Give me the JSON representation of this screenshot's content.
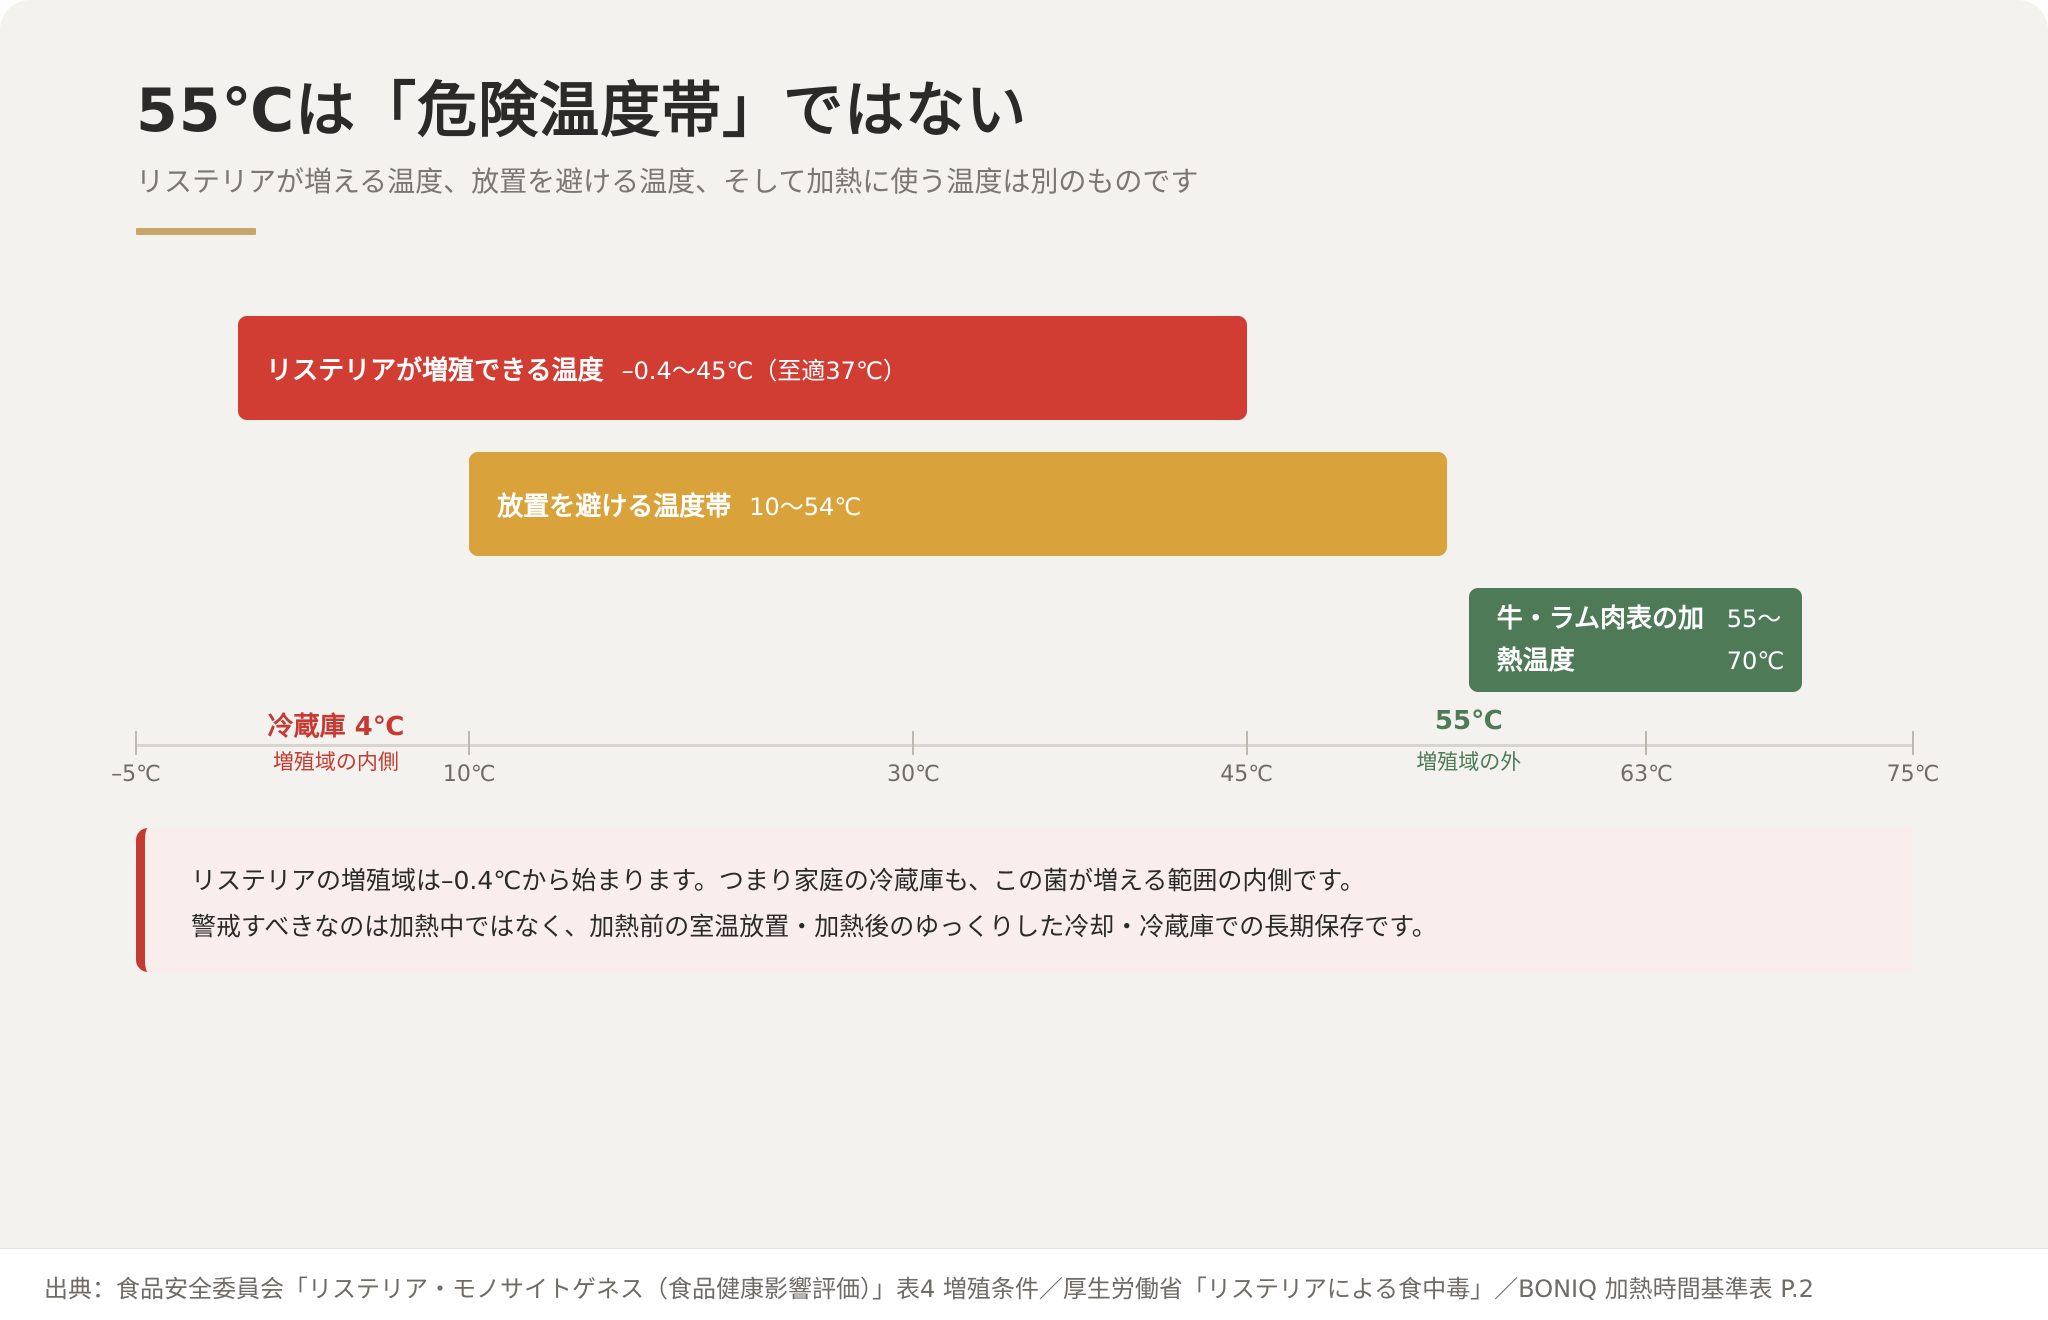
{
  "header": {
    "title": "55℃は「危険温度帯」ではない",
    "subtitle": "リステリアが増える温度、放置を避ける温度、そして加熱に使う温度は別のものです"
  },
  "colors": {
    "red": "#d13c33",
    "amber": "#d9a23b",
    "green": "#4e7a58",
    "accent": "#c9a56a",
    "background": "#f4f2ee"
  },
  "chart_data": {
    "type": "bar",
    "orientation": "horizontal-range",
    "x_unit": "℃",
    "xlim": [
      -5,
      75
    ],
    "ticks": [
      {
        "value": -5,
        "label": "–5℃"
      },
      {
        "value": 10,
        "label": "10℃"
      },
      {
        "value": 30,
        "label": "30℃"
      },
      {
        "value": 45,
        "label": "45℃"
      },
      {
        "value": 63,
        "label": "63℃"
      },
      {
        "value": 75,
        "label": "75℃"
      }
    ],
    "ranges": [
      {
        "name": "リステリアが増殖できる温度",
        "range_label": "–0.4〜45℃（至適37℃）",
        "start": -0.4,
        "end": 45,
        "color": "#d13c33"
      },
      {
        "name": "放置を避ける温度帯",
        "range_label": "10〜54℃",
        "start": 10,
        "end": 54,
        "color": "#d9a23b"
      },
      {
        "name": "牛・ラム肉表の加熱温度",
        "range_label": "55〜70℃",
        "start": 55,
        "end": 70,
        "color": "#4e7a58"
      }
    ],
    "markers": [
      {
        "value": 4,
        "label": "冷蔵庫 4℃",
        "note": "増殖域の内側",
        "color": "#c53a33"
      },
      {
        "value": 55,
        "label": "55℃",
        "note": "増殖域の外",
        "color": "#4e7a58"
      }
    ]
  },
  "note": {
    "line1": "リステリアの増殖域は–0.4℃から始まります。つまり家庭の冷蔵庫も、この菌が増える範囲の内側です。",
    "line2": "警戒すべきなのは加熱中ではなく、加熱前の室温放置・加熱後のゆっくりした冷却・冷蔵庫での長期保存です。"
  },
  "footer": {
    "source": "出典：食品安全委員会「リステリア・モノサイトゲネス（食品健康影響評価）」表4 増殖条件／厚生労働省「リステリアによる食中毒」／BONIQ 加熱時間基準表 P.2"
  }
}
